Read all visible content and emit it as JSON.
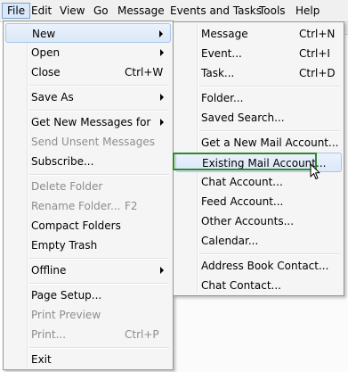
{
  "menubar": {
    "items": [
      "File",
      "Edit",
      "View",
      "Go",
      "Message",
      "Events and Tasks",
      "Tools",
      "Help"
    ]
  },
  "file_menu": {
    "items": [
      {
        "label": "New",
        "submenu": true
      },
      {
        "label": "Open",
        "submenu": true
      },
      {
        "label": "Close",
        "shortcut": "Ctrl+W"
      },
      {
        "label": "Save As",
        "submenu": true
      },
      {
        "label": "Get New Messages for",
        "submenu": true
      },
      {
        "label": "Send Unsent Messages",
        "disabled": true
      },
      {
        "label": "Subscribe..."
      },
      {
        "label": "Delete Folder",
        "disabled": true
      },
      {
        "label": "Rename Folder...",
        "shortcut": "F2",
        "disabled": true
      },
      {
        "label": "Compact Folders"
      },
      {
        "label": "Empty Trash"
      },
      {
        "label": "Offline",
        "submenu": true
      },
      {
        "label": "Page Setup..."
      },
      {
        "label": "Print Preview",
        "disabled": true
      },
      {
        "label": "Print...",
        "shortcut": "Ctrl+P",
        "disabled": true
      },
      {
        "label": "Exit"
      }
    ]
  },
  "new_submenu": {
    "items": [
      {
        "label": "Message",
        "shortcut": "Ctrl+N"
      },
      {
        "label": "Event...",
        "shortcut": "Ctrl+I"
      },
      {
        "label": "Task...",
        "shortcut": "Ctrl+D"
      },
      {
        "label": "Folder..."
      },
      {
        "label": "Saved Search..."
      },
      {
        "label": "Get a New Mail Account..."
      },
      {
        "label": "Existing Mail Account..."
      },
      {
        "label": "Chat Account..."
      },
      {
        "label": "Feed Account..."
      },
      {
        "label": "Other Accounts..."
      },
      {
        "label": "Calendar..."
      },
      {
        "label": "Address Book Contact..."
      },
      {
        "label": "Chat Contact..."
      }
    ]
  },
  "colors": {
    "highlight_border": "#a8c6ea",
    "callout": "#2d8a2d",
    "disabled_text": "#8d8d8d"
  },
  "icons": [
    "arrow-right-icon",
    "mouse-pointer-icon"
  ]
}
